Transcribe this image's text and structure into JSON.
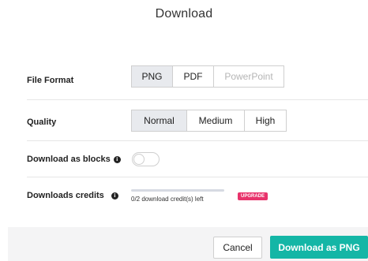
{
  "dialog": {
    "title": "Download"
  },
  "file_format": {
    "label": "File Format",
    "options": [
      "PNG",
      "PDF",
      "PowerPoint"
    ],
    "selected": "PNG",
    "disabled": [
      "PowerPoint"
    ]
  },
  "quality": {
    "label": "Quality",
    "options": [
      "Normal",
      "Medium",
      "High"
    ],
    "selected": "Normal"
  },
  "download_as_blocks": {
    "label": "Download as blocks",
    "enabled": false
  },
  "credits": {
    "label": "Downloads credits",
    "text": "0/2 download credit(s) left",
    "used_fraction": 0,
    "upgrade_label": "UPGRADE"
  },
  "footer": {
    "cancel_label": "Cancel",
    "download_label": "Download as PNG"
  },
  "colors": {
    "accent": "#14b6a6",
    "upgrade": "#e8336b"
  },
  "icons": {
    "info": "info-icon"
  }
}
